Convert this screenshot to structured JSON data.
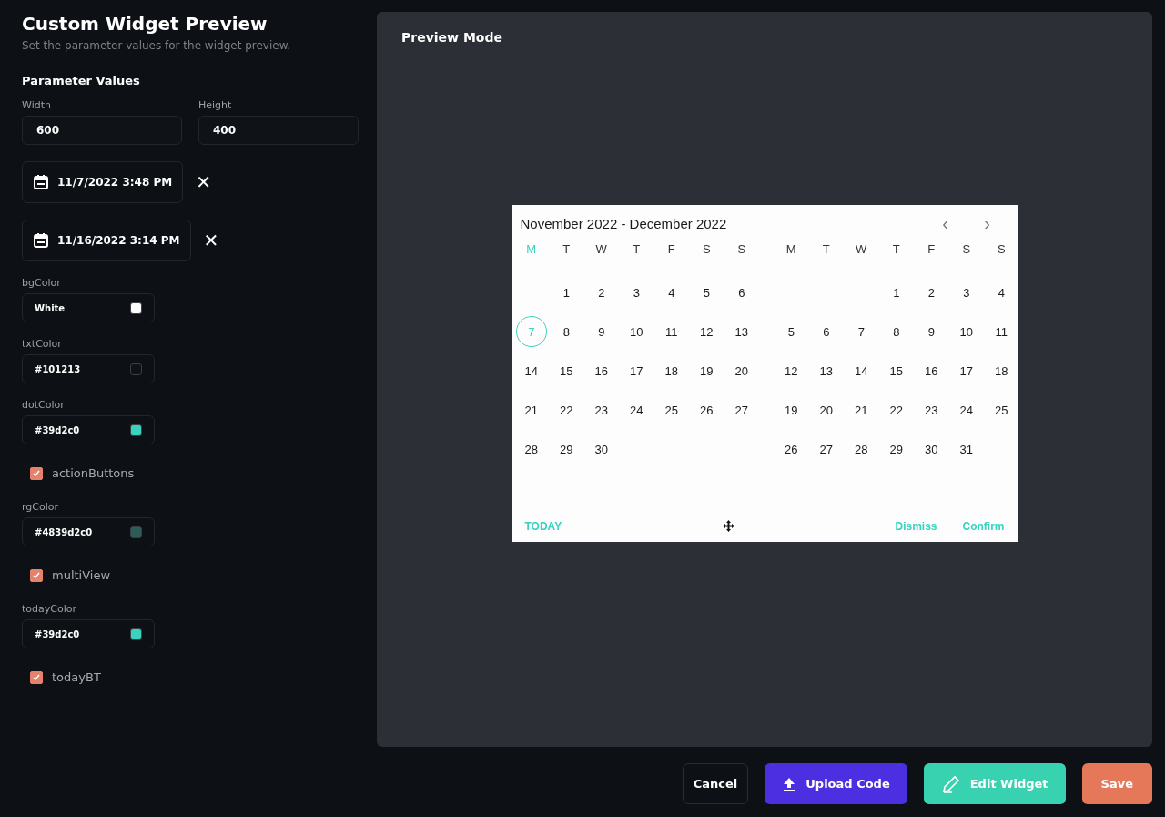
{
  "title": "Custom Widget Preview",
  "subtitle": "Set the parameter values for the widget preview.",
  "section": "Parameter Values",
  "size_fields": [
    {
      "label": "Width",
      "value": "600"
    },
    {
      "label": "Height",
      "value": "400"
    }
  ],
  "date_fields": [
    {
      "value": "11/7/2022 3:48 PM",
      "clear": "✕"
    },
    {
      "value": "11/16/2022 3:14 PM",
      "clear": "✕"
    }
  ],
  "params": [
    {
      "kind": "color",
      "label": "bgColor",
      "value": "White",
      "color": "#ffffff"
    },
    {
      "kind": "color",
      "label": "txtColor",
      "value": "#101213",
      "color": "#101213"
    },
    {
      "kind": "color",
      "label": "dotColor",
      "value": "#39d2c0",
      "color": "#39d2c0"
    },
    {
      "kind": "checkbox",
      "label": "actionButtons",
      "checked": true
    },
    {
      "kind": "color",
      "label": "rgColor",
      "value": "#4839d2c0",
      "color": "#2c5e57"
    },
    {
      "kind": "checkbox",
      "label": "multiView",
      "checked": true
    },
    {
      "kind": "color",
      "label": "todayColor",
      "value": "#39d2c0",
      "color": "#39d2c0"
    },
    {
      "kind": "checkbox",
      "label": "todayBT",
      "checked": true
    }
  ],
  "preview": {
    "title": "Preview Mode",
    "calendar": {
      "range": "November 2022 - December 2022",
      "prev": "‹",
      "next": "›",
      "months": [
        {
          "weekdays": [
            {
              "label": "M",
              "selected": true
            },
            {
              "label": "T",
              "selected": false
            },
            {
              "label": "W",
              "selected": false
            },
            {
              "label": "T",
              "selected": false
            },
            {
              "label": "F",
              "selected": false
            },
            {
              "label": "S",
              "selected": false
            },
            {
              "label": "S",
              "selected": false
            }
          ],
          "weeks": [
            [
              {
                "kind": "empty"
              },
              {
                "kind": "day",
                "d": "1",
                "selected": false
              },
              {
                "d": "2",
                "selected": false
              },
              {
                "d": "3",
                "selected": false
              },
              {
                "d": "4",
                "selected": false
              },
              {
                "d": "5",
                "selected": false
              },
              {
                "d": "6",
                "selected": false
              }
            ],
            [
              {
                "d": "7",
                "selected": true
              },
              {
                "d": "8",
                "selected": false
              },
              {
                "d": "9",
                "selected": false
              },
              {
                "d": "10",
                "selected": false
              },
              {
                "d": "11",
                "selected": false
              },
              {
                "d": "12",
                "selected": false
              },
              {
                "d": "13",
                "selected": false
              }
            ],
            [
              {
                "d": "14",
                "selected": false
              },
              {
                "d": "15",
                "selected": false
              },
              {
                "d": "16",
                "selected": false
              },
              {
                "d": "17",
                "selected": false
              },
              {
                "d": "18",
                "selected": false
              },
              {
                "d": "19",
                "selected": false
              },
              {
                "d": "20",
                "selected": false
              }
            ],
            [
              {
                "d": "21",
                "selected": false
              },
              {
                "d": "22",
                "selected": false
              },
              {
                "d": "23",
                "selected": false
              },
              {
                "d": "24",
                "selected": false
              },
              {
                "d": "25",
                "selected": false
              },
              {
                "d": "26",
                "selected": false
              },
              {
                "d": "27",
                "selected": false
              }
            ],
            [
              {
                "d": "28",
                "selected": false
              },
              {
                "d": "29",
                "selected": false
              },
              {
                "d": "30",
                "selected": false
              },
              {
                "kind": "empty"
              },
              {
                "kind": "empty"
              },
              {
                "kind": "empty"
              },
              {
                "kind": "empty"
              }
            ]
          ]
        },
        {
          "weekdays": [
            {
              "label": "M",
              "selected": false
            },
            {
              "label": "T",
              "selected": false
            },
            {
              "label": "W",
              "selected": false
            },
            {
              "label": "T",
              "selected": false
            },
            {
              "label": "F",
              "selected": false
            },
            {
              "label": "S",
              "selected": false
            },
            {
              "label": "S",
              "selected": false
            }
          ],
          "weeks": [
            [
              {
                "kind": "empty"
              },
              {
                "kind": "empty"
              },
              {
                "kind": "empty"
              },
              {
                "d": "1",
                "selected": false
              },
              {
                "d": "2",
                "selected": false
              },
              {
                "d": "3",
                "selected": false
              },
              {
                "d": "4",
                "selected": false
              }
            ],
            [
              {
                "d": "5",
                "selected": false
              },
              {
                "d": "6",
                "selected": false
              },
              {
                "d": "7",
                "selected": false
              },
              {
                "d": "8",
                "selected": false
              },
              {
                "d": "9",
                "selected": false
              },
              {
                "d": "10",
                "selected": false
              },
              {
                "d": "11",
                "selected": false
              }
            ],
            [
              {
                "d": "12",
                "selected": false
              },
              {
                "d": "13",
                "selected": false
              },
              {
                "d": "14",
                "selected": false
              },
              {
                "d": "15",
                "selected": false
              },
              {
                "d": "16",
                "selected": false
              },
              {
                "d": "17",
                "selected": false
              },
              {
                "d": "18",
                "selected": false
              }
            ],
            [
              {
                "d": "19",
                "selected": false
              },
              {
                "d": "20",
                "selected": false
              },
              {
                "d": "21",
                "selected": false
              },
              {
                "d": "22",
                "selected": false
              },
              {
                "d": "23",
                "selected": false
              },
              {
                "d": "24",
                "selected": false
              },
              {
                "d": "25",
                "selected": false
              }
            ],
            [
              {
                "d": "26",
                "selected": false
              },
              {
                "d": "27",
                "selected": false
              },
              {
                "d": "28",
                "selected": false
              },
              {
                "d": "29",
                "selected": false
              },
              {
                "d": "30",
                "selected": false
              },
              {
                "d": "31",
                "selected": false
              },
              {
                "kind": "empty"
              }
            ]
          ]
        }
      ],
      "actions": [
        {
          "kind": "today",
          "label": "TODAY"
        },
        {
          "kind": "dismiss",
          "label": "Dismiss"
        },
        {
          "kind": "confirm",
          "label": "Confirm"
        }
      ]
    }
  },
  "buttons": [
    {
      "kind": "cancel",
      "label": "Cancel"
    },
    {
      "kind": "upload",
      "label": "Upload Code"
    },
    {
      "kind": "edit",
      "label": "Edit Widget"
    },
    {
      "kind": "save",
      "label": "Save"
    }
  ]
}
